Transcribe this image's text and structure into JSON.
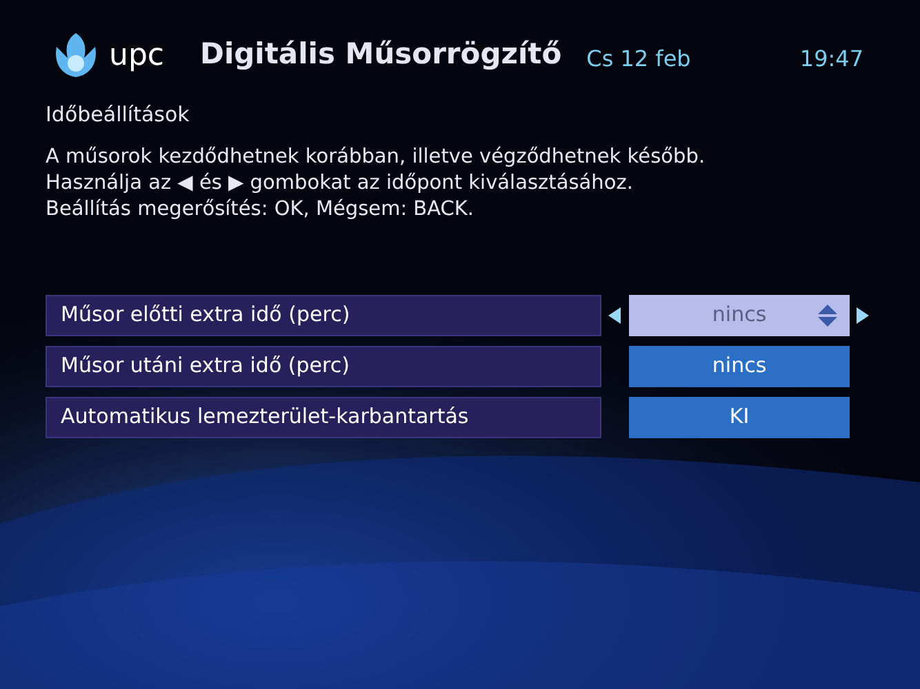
{
  "header": {
    "brand": "upc",
    "title": "Digitális Műsorrögzítő",
    "date": "Cs 12 feb",
    "time": "19:47"
  },
  "section_title": "Időbeállítások",
  "description": [
    "A műsorok kezdődhetnek korábban, illetve végződhetnek később.",
    "Használja az ◀ és ▶ gombokat az időpont kiválasztásához.",
    "Beállítás megerősítés: OK, Mégsem: BACK."
  ],
  "settings": [
    {
      "label": "Műsor előtti extra idő (perc)",
      "value": "nincs",
      "selected": true
    },
    {
      "label": "Műsor utáni extra idő (perc)",
      "value": "nincs",
      "selected": false
    },
    {
      "label": "Automatikus lemezterület-karbantartás",
      "value": "KI",
      "selected": false
    }
  ]
}
